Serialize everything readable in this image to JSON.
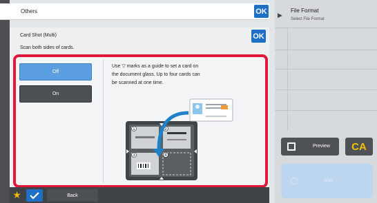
{
  "others": {
    "title": "Others",
    "ok_label": "OK"
  },
  "card_shot": {
    "title": "Card Shot (Multi)",
    "subtitle": "Scan both sides of cards.",
    "ok_label": "OK",
    "options": [
      "Off",
      "On"
    ],
    "selected": "Off",
    "instruction_line1": "Use ▽ marks as a guide to set a card on",
    "instruction_line2": "the document glass. Up to four cards can",
    "instruction_line3": "be scanned at one time.",
    "slots": [
      "1",
      "2",
      "3",
      "4"
    ]
  },
  "file_format": {
    "title": "File Format",
    "subtitle": "Select File Format"
  },
  "actions": {
    "preview_label": "Preview",
    "ca_label": "CA",
    "start_label": "Start"
  },
  "bottom": {
    "back_label": "Back"
  },
  "colors": {
    "accent": "#1f6fc4",
    "highlight": "#e3173a",
    "selected_option": "#5b9fe0",
    "ca_text": "#f2c200"
  }
}
